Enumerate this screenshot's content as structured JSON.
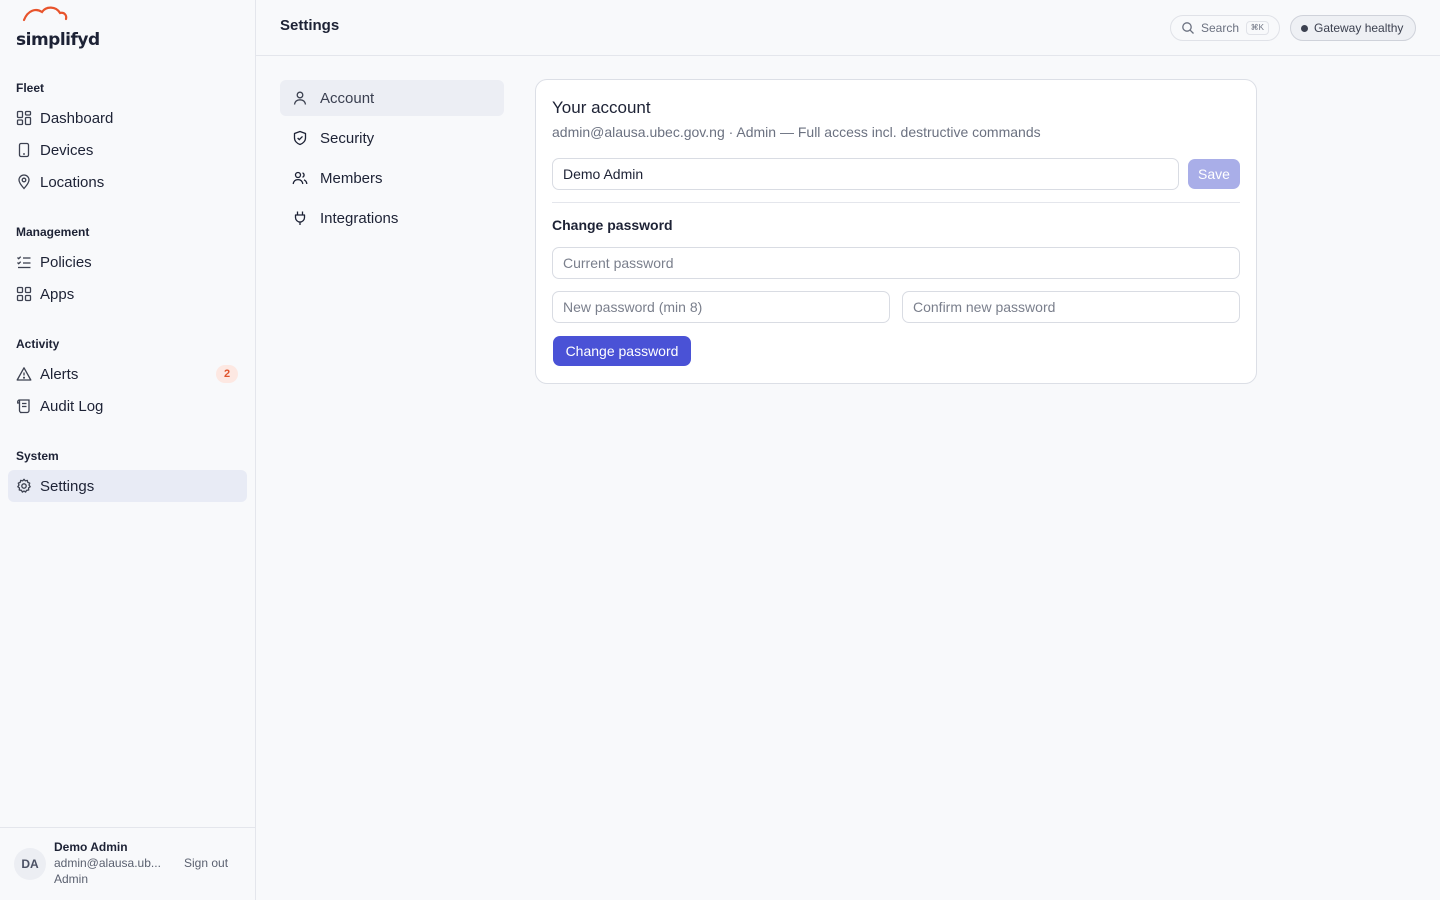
{
  "brand": {
    "name": "simplifyd",
    "accent": "#e8542c"
  },
  "sidebar": {
    "sections": [
      {
        "title": "Fleet",
        "items": [
          {
            "label": "Dashboard",
            "icon": "dashboard-icon"
          },
          {
            "label": "Devices",
            "icon": "device-icon"
          },
          {
            "label": "Locations",
            "icon": "location-pin-icon"
          }
        ]
      },
      {
        "title": "Management",
        "items": [
          {
            "label": "Policies",
            "icon": "checklist-icon"
          },
          {
            "label": "Apps",
            "icon": "apps-grid-icon"
          }
        ]
      },
      {
        "title": "Activity",
        "items": [
          {
            "label": "Alerts",
            "icon": "alert-triangle-icon",
            "badge": "2"
          },
          {
            "label": "Audit Log",
            "icon": "scroll-icon"
          }
        ]
      },
      {
        "title": "System",
        "items": [
          {
            "label": "Settings",
            "icon": "gear-icon",
            "active": true
          }
        ]
      }
    ]
  },
  "user": {
    "initials": "DA",
    "name": "Demo Admin",
    "email": "admin@alausa.ub...",
    "role": "Admin",
    "signout_label": "Sign out"
  },
  "topbar": {
    "title": "Settings",
    "search_label": "Search",
    "search_shortcut": "⌘K",
    "status_label": "Gateway healthy"
  },
  "settings_nav": [
    {
      "label": "Account",
      "icon": "user-icon",
      "active": true
    },
    {
      "label": "Security",
      "icon": "shield-icon"
    },
    {
      "label": "Members",
      "icon": "users-icon"
    },
    {
      "label": "Integrations",
      "icon": "plug-icon"
    }
  ],
  "account": {
    "title": "Your account",
    "subtitle": "admin@alausa.ubec.gov.ng · Admin — Full access incl. destructive commands",
    "name_value": "Demo Admin",
    "save_label": "Save",
    "password_heading": "Change password",
    "current_password_placeholder": "Current password",
    "new_password_placeholder": "New password (min 8)",
    "confirm_password_placeholder": "Confirm new password",
    "change_password_label": "Change password"
  }
}
